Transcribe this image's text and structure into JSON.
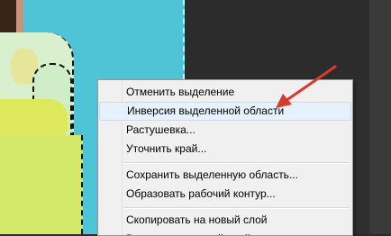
{
  "menu": {
    "items": [
      {
        "label": "Отменить выделение",
        "highlighted": false
      },
      {
        "label": "Инверсия выделенной области",
        "highlighted": true
      },
      {
        "label": "Растушевка...",
        "highlighted": false
      },
      {
        "label": "Уточнить край...",
        "highlighted": false
      },
      {
        "label": "Сохранить выделенную область...",
        "highlighted": false
      },
      {
        "label": "Образовать рабочий контур...",
        "highlighted": false
      },
      {
        "label": "Скопировать на новый слой",
        "highlighted": false
      },
      {
        "label": "Вырезать на новый слой",
        "highlighted": false
      }
    ]
  },
  "colors": {
    "arrow": "#d93a2b",
    "highlight": "#e5f1fb",
    "photo_background": "#4ec4d6"
  }
}
